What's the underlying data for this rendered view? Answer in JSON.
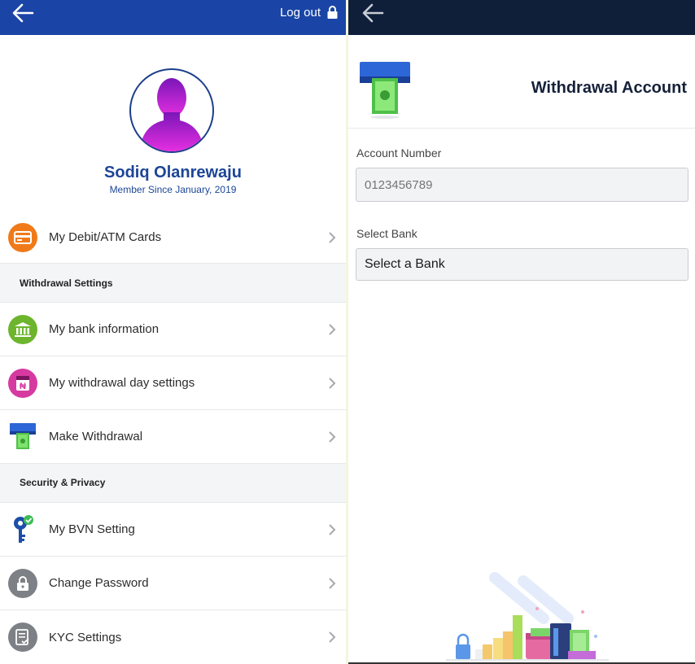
{
  "left": {
    "header": {
      "logout_label": "Log out"
    },
    "profile": {
      "name": "Sodiq Olanrewaju",
      "member_since": "Member Since January, 2019"
    },
    "menu": {
      "cards": "My Debit/ATM Cards",
      "withdrawal_settings_title": "Withdrawal Settings",
      "bank_info": "My bank information",
      "withdrawal_day": "My withdrawal day settings",
      "make_withdrawal": "Make Withdrawal",
      "security_title": "Security & Privacy",
      "bvn": "My BVN Setting",
      "change_password": "Change Password",
      "kyc": "KYC Settings"
    },
    "icons": {
      "back": "arrow-left-icon",
      "logout": "lock-icon",
      "cards": "credit-card-icon",
      "bank": "bank-building-icon",
      "withdrawal_day": "calendar-money-icon",
      "make_withdrawal": "atm-cash-icon",
      "bvn": "key-check-icon",
      "password": "padlock-icon",
      "kyc": "document-check-icon",
      "chevron": "chevron-right-icon"
    }
  },
  "right": {
    "title": "Withdrawal Account",
    "account_number": {
      "label": "Account Number",
      "placeholder": "0123456789",
      "value": ""
    },
    "bank": {
      "label": "Select Bank",
      "selected": "Select a Bank"
    }
  },
  "colors": {
    "left_header": "#1a45a6",
    "right_header": "#0f1f3a",
    "brand_text": "#1c4597",
    "cards_icon_bg": "#f07a1a",
    "bank_icon_bg": "#6cb52d",
    "withdrawal_day_icon_bg": "#d63aa0",
    "password_icon_bg": "#7d8085",
    "kyc_icon_bg": "#7d8085"
  }
}
